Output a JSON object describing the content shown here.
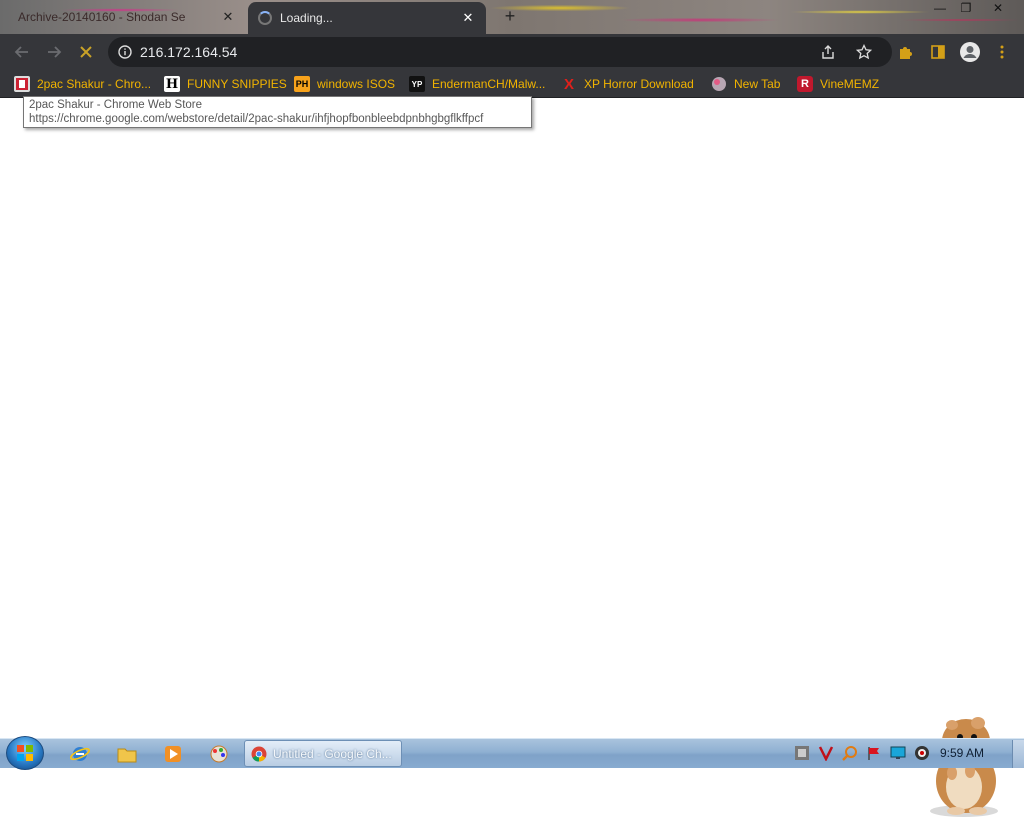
{
  "tabs": [
    {
      "title": "Archive-20140160 - Shodan Se",
      "close_glyph": "✕",
      "active": false
    },
    {
      "title": "Loading...",
      "close_glyph": "✕",
      "active": true
    }
  ],
  "new_tab_glyph": "+",
  "window_controls": {
    "minimize": "—",
    "maximize": "❐",
    "close": "✕"
  },
  "toolbar": {
    "back_icon": "arrow-left-icon",
    "forward_icon": "arrow-right-icon",
    "stop_icon": "stop-x-icon",
    "url": "216.172.164.54",
    "info_icon": "info-icon",
    "share_icon": "share-icon",
    "bookmark_star_icon": "star-icon",
    "extensions_icon": "puzzle-icon",
    "side_panel_icon": "side-panel-icon",
    "profile_icon": "avatar-icon",
    "menu_icon": "kebab-menu-icon"
  },
  "bookmarks": [
    {
      "label": "2pac Shakur - Chro...",
      "favicon": "2pac-favicon"
    },
    {
      "label": "FUNNY SNIPPIES",
      "favicon": "H"
    },
    {
      "label": "windows ISOS",
      "favicon": "PH"
    },
    {
      "label": "EndermanCH/Malw...",
      "favicon": "YP"
    },
    {
      "label": "XP Horror Download",
      "favicon": "X"
    },
    {
      "label": "New Tab",
      "favicon": "globe-favicon"
    },
    {
      "label": "VineMEMZ",
      "favicon": "R"
    }
  ],
  "tooltip": {
    "title": "2pac Shakur - Chrome Web Store",
    "url": "https://chrome.google.com/webstore/detail/2pac-shakur/ihfjhopfbonbleebdpnbhgbgflkffpcf"
  },
  "taskbar": {
    "chrome_task_label": "Untitled - Google Ch...",
    "clock": "9:59 AM",
    "quick_launch": [
      "internet-explorer-icon",
      "folder-icon",
      "media-player-icon",
      "paint-icon"
    ]
  },
  "colors": {
    "chrome_dark": "#35363a",
    "omnibox": "#202124",
    "bookmark_text": "#f2b400",
    "taskbar": "#8fb0d2"
  }
}
